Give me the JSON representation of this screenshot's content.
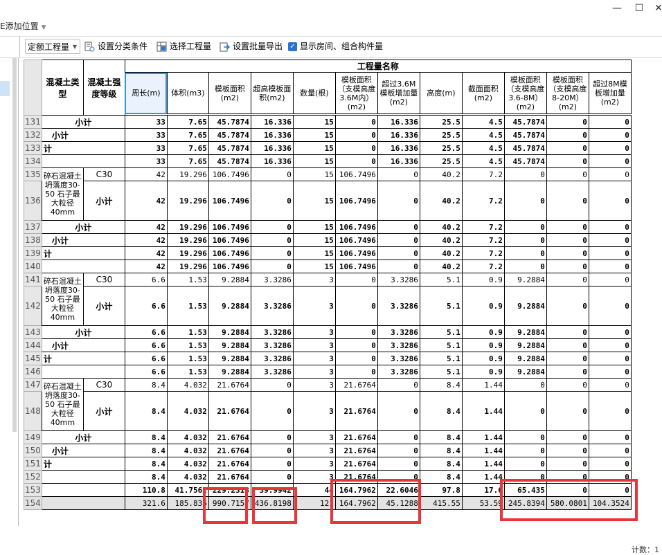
{
  "window": {
    "minimize_icon": "—",
    "maximize_icon": "☐",
    "close_icon": "✕"
  },
  "add_position_label": "E添加位置",
  "toolbar": {
    "quota_select": "定额工程量",
    "set_category": "设置分类条件",
    "select_quantity": "选择工程量",
    "batch_export": "设置批量导出",
    "show_rooms": "显示房间、组合构件量"
  },
  "table": {
    "group_header": "工程量名称",
    "headers": {
      "concrete_type": "混凝土类型",
      "strength": "混凝土强度等级",
      "cols": [
        "周长(m)",
        "体积(m3)",
        "模板面积(m2)",
        "超高模板面积(m2)",
        "数量(根)",
        "模板面积（支模高度3.6M内）(m2)",
        "超过3.6M模板增加量(m2)",
        "高度(m)",
        "截面面积(m2)",
        "模板面积（支模高度3.6-8M）(m2)",
        "模板面积（支模高度8-20M）(m2)",
        "超过8M模板增加量(m2)"
      ]
    },
    "concrete_desc": "碎石混凝土 坍落度30-50 石子最大粒径40mm",
    "strength_value": "C30",
    "subtotal": "小计",
    "ji": "计",
    "rows": [
      {
        "n": "131",
        "vals": [
          "33",
          "7.65",
          "45.7874",
          "16.336",
          "15",
          "0",
          "16.336",
          "25.5",
          "4.5",
          "45.7874",
          "0",
          "0"
        ]
      },
      {
        "n": "132",
        "vals": [
          "33",
          "7.65",
          "45.7874",
          "16.336",
          "15",
          "0",
          "16.336",
          "25.5",
          "4.5",
          "45.7874",
          "0",
          "0"
        ]
      },
      {
        "n": "133",
        "vals": [
          "33",
          "7.65",
          "45.7874",
          "16.336",
          "15",
          "0",
          "16.336",
          "25.5",
          "4.5",
          "45.7874",
          "0",
          "0"
        ]
      },
      {
        "n": "134",
        "vals": [
          "33",
          "7.65",
          "45.7874",
          "16.336",
          "15",
          "0",
          "16.336",
          "25.5",
          "4.5",
          "45.7874",
          "0",
          "0"
        ]
      },
      {
        "n": "135",
        "vals": [
          "42",
          "19.296",
          "106.7496",
          "0",
          "15",
          "106.7496",
          "0",
          "40.2",
          "7.2",
          "0",
          "0",
          "0"
        ]
      },
      {
        "n": "136",
        "vals": [
          "42",
          "19.296",
          "106.7496",
          "0",
          "15",
          "106.7496",
          "0",
          "40.2",
          "7.2",
          "0",
          "0",
          "0"
        ]
      },
      {
        "n": "137",
        "vals": [
          "42",
          "19.296",
          "106.7496",
          "0",
          "15",
          "106.7496",
          "0",
          "40.2",
          "7.2",
          "0",
          "0",
          "0"
        ]
      },
      {
        "n": "138",
        "vals": [
          "42",
          "19.296",
          "106.7496",
          "0",
          "15",
          "106.7496",
          "0",
          "40.2",
          "7.2",
          "0",
          "0",
          "0"
        ]
      },
      {
        "n": "139",
        "vals": [
          "42",
          "19.296",
          "106.7496",
          "0",
          "15",
          "106.7496",
          "0",
          "40.2",
          "7.2",
          "0",
          "0",
          "0"
        ]
      },
      {
        "n": "140",
        "vals": [
          "42",
          "19.296",
          "106.7496",
          "0",
          "15",
          "106.7496",
          "0",
          "40.2",
          "7.2",
          "0",
          "0",
          "0"
        ]
      },
      {
        "n": "141",
        "vals": [
          "6.6",
          "1.53",
          "9.2884",
          "3.3286",
          "3",
          "0",
          "3.3286",
          "5.1",
          "0.9",
          "9.2884",
          "0",
          "0"
        ]
      },
      {
        "n": "142",
        "vals": [
          "6.6",
          "1.53",
          "9.2884",
          "3.3286",
          "3",
          "0",
          "3.3286",
          "5.1",
          "0.9",
          "9.2884",
          "0",
          "0"
        ]
      },
      {
        "n": "143",
        "vals": [
          "6.6",
          "1.53",
          "9.2884",
          "3.3286",
          "3",
          "0",
          "3.3286",
          "5.1",
          "0.9",
          "9.2884",
          "0",
          "0"
        ]
      },
      {
        "n": "144",
        "vals": [
          "6.6",
          "1.53",
          "9.2884",
          "3.3286",
          "3",
          "0",
          "3.3286",
          "5.1",
          "0.9",
          "9.2884",
          "0",
          "0"
        ]
      },
      {
        "n": "145",
        "vals": [
          "6.6",
          "1.53",
          "9.2884",
          "3.3286",
          "3",
          "0",
          "3.3286",
          "5.1",
          "0.9",
          "9.2884",
          "0",
          "0"
        ]
      },
      {
        "n": "146",
        "vals": [
          "6.6",
          "1.53",
          "9.2884",
          "3.3286",
          "3",
          "0",
          "3.3286",
          "5.1",
          "0.9",
          "9.2884",
          "0",
          "0"
        ]
      },
      {
        "n": "147",
        "vals": [
          "8.4",
          "4.032",
          "21.6764",
          "0",
          "3",
          "21.6764",
          "0",
          "8.4",
          "1.44",
          "0",
          "0",
          "0"
        ]
      },
      {
        "n": "148",
        "vals": [
          "8.4",
          "4.032",
          "21.6764",
          "0",
          "3",
          "21.6764",
          "0",
          "8.4",
          "1.44",
          "0",
          "0",
          "0"
        ]
      },
      {
        "n": "149",
        "vals": [
          "8.4",
          "4.032",
          "21.6764",
          "0",
          "3",
          "21.6764",
          "0",
          "8.4",
          "1.44",
          "0",
          "0",
          "0"
        ]
      },
      {
        "n": "150",
        "vals": [
          "8.4",
          "4.032",
          "21.6764",
          "0",
          "3",
          "21.6764",
          "0",
          "8.4",
          "1.44",
          "0",
          "0",
          "0"
        ]
      },
      {
        "n": "151",
        "vals": [
          "8.4",
          "4.032",
          "21.6764",
          "0",
          "3",
          "21.6764",
          "0",
          "8.4",
          "1.44",
          "0",
          "0",
          "0"
        ]
      },
      {
        "n": "152",
        "vals": [
          "8.4",
          "4.032",
          "21.6764",
          "0",
          "3",
          "21.6764",
          "0",
          "8.4",
          "1.44",
          "0",
          "0",
          "0"
        ]
      },
      {
        "n": "153",
        "vals": [
          "110.8",
          "41.7562",
          "229.2318",
          "39.9942",
          "44",
          "164.7962",
          "22.6046",
          "97.8",
          "17.6",
          "65.435",
          "0",
          "0"
        ]
      },
      {
        "n": "154",
        "vals": [
          "321.6",
          "185.836",
          "990.7157",
          "436.8198",
          "121",
          "164.7962",
          "45.1288",
          "415.55",
          "53.59",
          "245.8394",
          "580.0801",
          "104.3524"
        ]
      }
    ]
  },
  "status_text": "计数：1"
}
